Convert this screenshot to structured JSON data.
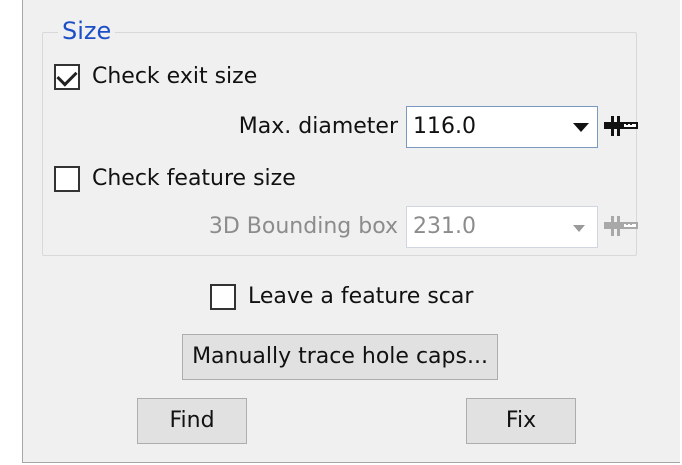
{
  "size_group": {
    "title": "Size",
    "check_exit_size": {
      "label": "Check exit size",
      "checked": true
    },
    "max_diameter": {
      "label": "Max. diameter",
      "value": "116.0",
      "icon": "ruler-icon"
    },
    "check_feature_size": {
      "label": "Check feature size",
      "checked": false
    },
    "bounding_box": {
      "label": "3D Bounding box",
      "value": "231.0",
      "enabled": false,
      "icon": "ruler-icon"
    }
  },
  "leave_scar": {
    "label": "Leave a feature scar",
    "checked": false
  },
  "buttons": {
    "trace": "Manually trace hole caps...",
    "find": "Find",
    "fix": "Fix"
  },
  "colors": {
    "group_title": "#1c4fc7",
    "disabled_text": "#8c8c8c",
    "panel_bg": "#f0f0f0"
  }
}
